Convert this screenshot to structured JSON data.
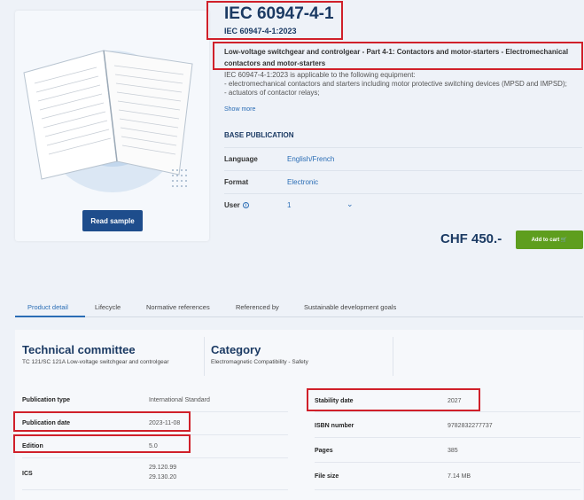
{
  "product": {
    "read_sample": "Read sample",
    "title": "IEC 60947-4-1",
    "subtitle": "IEC 60947-4-1:2023",
    "long_title": "Low-voltage switchgear and controlgear - Part 4-1: Contactors and motor-starters - Electromechanical contactors and motor-starters",
    "desc_lines": [
      "IEC 60947-4-1:2023 is applicable to the following equipment:",
      "- electromechanical contactors and starters including motor protective switching devices (MPSD and IMPSD);",
      "- actuators of contactor relays;"
    ],
    "show_more": "Show more",
    "base_publication": "BASE PUBLICATION",
    "options": [
      {
        "label": "Language",
        "value": "English/French"
      },
      {
        "label": "Format",
        "value": "Electronic"
      },
      {
        "label": "User",
        "value": "1"
      }
    ],
    "info_icon": "i",
    "price": "CHF 450.-",
    "add_to_cart": "Add to cart"
  },
  "tabs": [
    "Product detail",
    "Lifecycle",
    "Normative references",
    "Referenced by",
    "Sustainable development goals"
  ],
  "details": {
    "tc_title": "Technical committee",
    "tc_value": "TC 121/SC 121A Low-voltage switchgear and controlgear",
    "cat_title": "Category",
    "cat_value": "Electromagnetic Compatibility - Safety",
    "left": [
      {
        "label": "Publication type",
        "value": "International Standard"
      },
      {
        "label": "Publication date",
        "value": "2023-11-08"
      },
      {
        "label": "Edition",
        "value": "5.0"
      },
      {
        "label": "ICS",
        "value": "29.120.99",
        "value2": "29.130.20"
      }
    ],
    "right": [
      {
        "label": "Stability date",
        "value": "2027"
      },
      {
        "label": "ISBN number",
        "value": "9782832277737"
      },
      {
        "label": "Pages",
        "value": "385"
      },
      {
        "label": "File size",
        "value": "7.14 MB"
      }
    ]
  },
  "colors": {
    "accent": "#2a6db5",
    "primary": "#1b3a63",
    "cart": "#5e9e1e",
    "highlight": "#d0202a"
  },
  "icons": [
    "info-icon",
    "chevron-down-icon",
    "cart-icon"
  ]
}
